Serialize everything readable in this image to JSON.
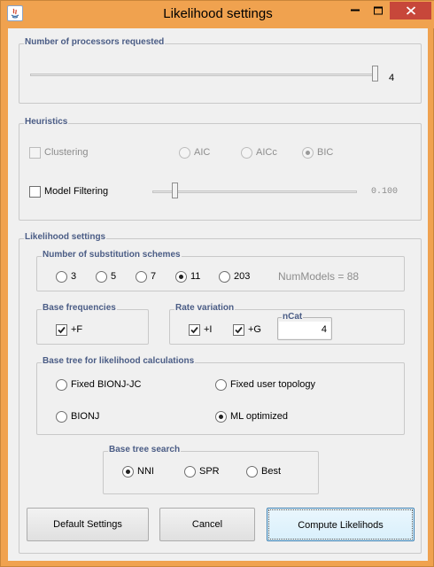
{
  "window": {
    "title": "Likelihood settings"
  },
  "processors": {
    "legend": "Number of processors requested",
    "value": "4",
    "slider_fraction": 1.0
  },
  "heuristics": {
    "legend": "Heuristics",
    "clustering_label": "Clustering",
    "clustering_checked": false,
    "clustering_enabled": false,
    "criteria": [
      {
        "label": "AIC",
        "selected": false
      },
      {
        "label": "AICc",
        "selected": false
      },
      {
        "label": "BIC",
        "selected": true
      }
    ],
    "model_filtering_label": "Model Filtering",
    "model_filtering_checked": false,
    "filter_value": "0.100",
    "filter_slider_fraction": 0.1
  },
  "likelihood": {
    "legend": "Likelihood settings",
    "schemes": {
      "legend": "Number of substitution schemes",
      "options": [
        {
          "label": "3",
          "selected": false
        },
        {
          "label": "5",
          "selected": false
        },
        {
          "label": "7",
          "selected": false
        },
        {
          "label": "11",
          "selected": true
        },
        {
          "label": "203",
          "selected": false
        }
      ],
      "num_models": "NumModels = 88"
    },
    "base_frequencies": {
      "legend": "Base frequencies",
      "f_label": "+F",
      "f_checked": true
    },
    "rate_variation": {
      "legend": "Rate variation",
      "i_label": "+I",
      "i_checked": true,
      "g_label": "+G",
      "g_checked": true,
      "ncat_legend": "nCat",
      "ncat_value": "4"
    },
    "base_tree": {
      "legend": "Base tree for likelihood calculations",
      "options": [
        {
          "label": "Fixed BIONJ-JC",
          "selected": false
        },
        {
          "label": "Fixed user topology",
          "selected": false
        },
        {
          "label": "BIONJ",
          "selected": false
        },
        {
          "label": "ML optimized",
          "selected": true
        }
      ]
    },
    "tree_search": {
      "legend": "Base tree search",
      "options": [
        {
          "label": "NNI",
          "selected": true
        },
        {
          "label": "SPR",
          "selected": false
        },
        {
          "label": "Best",
          "selected": false
        }
      ]
    }
  },
  "buttons": {
    "default_settings": "Default Settings",
    "cancel": "Cancel",
    "compute": "Compute Likelihods"
  },
  "colors": {
    "titlebar": "#f0a24f",
    "close_button": "#c7473a",
    "legend_text": "#4a5c85",
    "client_bg": "#f0f0f0"
  }
}
